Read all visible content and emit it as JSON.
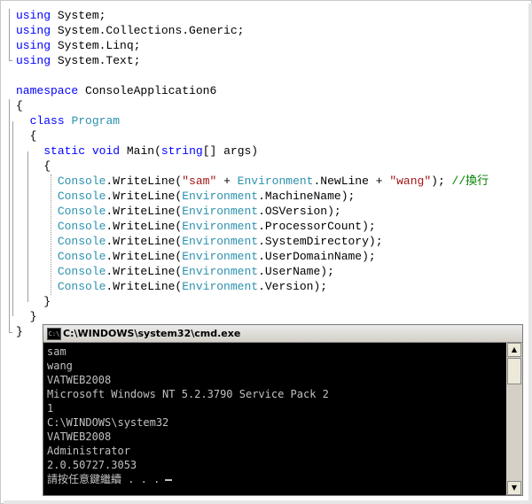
{
  "editor": {
    "lines": [
      [
        {
          "c": "kw",
          "t": "using"
        },
        {
          "c": "",
          "t": " System;"
        }
      ],
      [
        {
          "c": "kw",
          "t": "using"
        },
        {
          "c": "",
          "t": " System.Collections.Generic;"
        }
      ],
      [
        {
          "c": "kw",
          "t": "using"
        },
        {
          "c": "",
          "t": " System.Linq;"
        }
      ],
      [
        {
          "c": "kw",
          "t": "using"
        },
        {
          "c": "",
          "t": " System.Text;"
        }
      ],
      [],
      [
        {
          "c": "kw",
          "t": "namespace"
        },
        {
          "c": "",
          "t": " ConsoleApplication6"
        }
      ],
      [
        {
          "c": "",
          "t": "{"
        }
      ],
      [
        {
          "c": "",
          "t": "  "
        },
        {
          "c": "kw",
          "t": "class"
        },
        {
          "c": "",
          "t": " "
        },
        {
          "c": "ty",
          "t": "Program"
        }
      ],
      [
        {
          "c": "",
          "t": "  {"
        }
      ],
      [
        {
          "c": "",
          "t": "    "
        },
        {
          "c": "kw",
          "t": "static"
        },
        {
          "c": "",
          "t": " "
        },
        {
          "c": "kw",
          "t": "void"
        },
        {
          "c": "",
          "t": " Main("
        },
        {
          "c": "kw",
          "t": "string"
        },
        {
          "c": "",
          "t": "[] args)"
        }
      ],
      [
        {
          "c": "",
          "t": "    {"
        }
      ],
      [
        {
          "c": "",
          "t": "      "
        },
        {
          "c": "ty",
          "t": "Console"
        },
        {
          "c": "",
          "t": ".WriteLine("
        },
        {
          "c": "str",
          "t": "\"sam\""
        },
        {
          "c": "",
          "t": " + "
        },
        {
          "c": "ty",
          "t": "Environment"
        },
        {
          "c": "",
          "t": ".NewLine + "
        },
        {
          "c": "str",
          "t": "\"wang\""
        },
        {
          "c": "",
          "t": "); "
        },
        {
          "c": "cm",
          "t": "//換行"
        }
      ],
      [
        {
          "c": "",
          "t": "      "
        },
        {
          "c": "ty",
          "t": "Console"
        },
        {
          "c": "",
          "t": ".WriteLine("
        },
        {
          "c": "ty",
          "t": "Environment"
        },
        {
          "c": "",
          "t": ".MachineName);"
        }
      ],
      [
        {
          "c": "",
          "t": "      "
        },
        {
          "c": "ty",
          "t": "Console"
        },
        {
          "c": "",
          "t": ".WriteLine("
        },
        {
          "c": "ty",
          "t": "Environment"
        },
        {
          "c": "",
          "t": ".OSVersion);"
        }
      ],
      [
        {
          "c": "",
          "t": "      "
        },
        {
          "c": "ty",
          "t": "Console"
        },
        {
          "c": "",
          "t": ".WriteLine("
        },
        {
          "c": "ty",
          "t": "Environment"
        },
        {
          "c": "",
          "t": ".ProcessorCount);"
        }
      ],
      [
        {
          "c": "",
          "t": "      "
        },
        {
          "c": "ty",
          "t": "Console"
        },
        {
          "c": "",
          "t": ".WriteLine("
        },
        {
          "c": "ty",
          "t": "Environment"
        },
        {
          "c": "",
          "t": ".SystemDirectory);"
        }
      ],
      [
        {
          "c": "",
          "t": "      "
        },
        {
          "c": "ty",
          "t": "Console"
        },
        {
          "c": "",
          "t": ".WriteLine("
        },
        {
          "c": "ty",
          "t": "Environment"
        },
        {
          "c": "",
          "t": ".UserDomainName);"
        }
      ],
      [
        {
          "c": "",
          "t": "      "
        },
        {
          "c": "ty",
          "t": "Console"
        },
        {
          "c": "",
          "t": ".WriteLine("
        },
        {
          "c": "ty",
          "t": "Environment"
        },
        {
          "c": "",
          "t": ".UserName);"
        }
      ],
      [
        {
          "c": "",
          "t": "      "
        },
        {
          "c": "ty",
          "t": "Console"
        },
        {
          "c": "",
          "t": ".WriteLine("
        },
        {
          "c": "ty",
          "t": "Environment"
        },
        {
          "c": "",
          "t": ".Version);"
        }
      ],
      [
        {
          "c": "",
          "t": "    }"
        }
      ],
      [
        {
          "c": "",
          "t": "  }"
        }
      ],
      [
        {
          "c": "",
          "t": "}"
        }
      ]
    ]
  },
  "console": {
    "title": "C:\\WINDOWS\\system32\\cmd.exe",
    "icon_label": "C:\\",
    "output": [
      "sam",
      "wang",
      "VATWEB2008",
      "Microsoft Windows NT 5.2.3790 Service Pack 2",
      "1",
      "C:\\WINDOWS\\system32",
      "VATWEB2008",
      "Administrator",
      "2.0.50727.3053"
    ],
    "prompt": "請按任意鍵繼續 . . ."
  },
  "colors": {
    "keyword": "#0000ff",
    "type": "#2b91af",
    "string": "#a31515",
    "comment": "#008000",
    "console_bg": "#000000",
    "console_text": "#c0c0c0"
  }
}
